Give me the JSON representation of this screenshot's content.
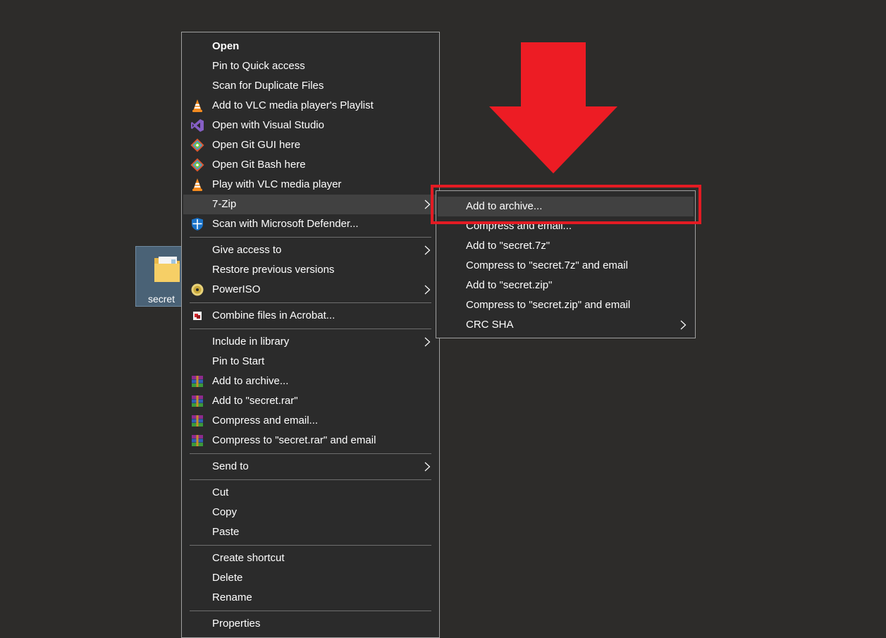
{
  "desktop": {
    "folder_label": "secret"
  },
  "context_menu": {
    "items": [
      {
        "label": "Open",
        "icon": "none",
        "bold": true
      },
      {
        "label": "Pin to Quick access",
        "icon": "none"
      },
      {
        "label": "Scan for Duplicate Files",
        "icon": "none"
      },
      {
        "label": "Add to VLC media player's Playlist",
        "icon": "vlc-cone-icon"
      },
      {
        "label": "Open with Visual Studio",
        "icon": "visual-studio-icon"
      },
      {
        "label": "Open Git GUI here",
        "icon": "git-icon"
      },
      {
        "label": "Open Git Bash here",
        "icon": "git-icon"
      },
      {
        "label": "Play with VLC media player",
        "icon": "vlc-cone-icon"
      },
      {
        "label": "7-Zip",
        "icon": "none",
        "submenu": true,
        "highlighted": true
      },
      {
        "label": "Scan with Microsoft Defender...",
        "icon": "defender-shield-icon"
      },
      {
        "label": "Give access to",
        "icon": "none",
        "submenu": true
      },
      {
        "label": "Restore previous versions",
        "icon": "none"
      },
      {
        "label": "PowerISO",
        "icon": "poweriso-disc-icon",
        "submenu": true
      },
      {
        "label": "Combine files in Acrobat...",
        "icon": "acrobat-icon"
      },
      {
        "label": "Include in library",
        "icon": "none",
        "submenu": true
      },
      {
        "label": "Pin to Start",
        "icon": "none"
      },
      {
        "label": "Add to archive...",
        "icon": "winrar-icon"
      },
      {
        "label": "Add to \"secret.rar\"",
        "icon": "winrar-icon"
      },
      {
        "label": "Compress and email...",
        "icon": "winrar-icon"
      },
      {
        "label": "Compress to \"secret.rar\" and email",
        "icon": "winrar-icon"
      },
      {
        "label": "Send to",
        "icon": "none",
        "submenu": true
      },
      {
        "label": "Cut",
        "icon": "none"
      },
      {
        "label": "Copy",
        "icon": "none"
      },
      {
        "label": "Paste",
        "icon": "none"
      },
      {
        "label": "Create shortcut",
        "icon": "none"
      },
      {
        "label": "Delete",
        "icon": "none"
      },
      {
        "label": "Rename",
        "icon": "none"
      },
      {
        "label": "Properties",
        "icon": "none"
      }
    ]
  },
  "zip_submenu": {
    "items": [
      {
        "label": "Add to archive...",
        "highlighted": true
      },
      {
        "label": "Compress and email..."
      },
      {
        "label": "Add to \"secret.7z\""
      },
      {
        "label": "Compress to \"secret.7z\" and email"
      },
      {
        "label": "Add to \"secret.zip\""
      },
      {
        "label": "Compress to \"secret.zip\" and email"
      },
      {
        "label": "CRC SHA",
        "submenu": true
      }
    ]
  },
  "colors": {
    "desktop_background": "#2d2c2a",
    "menu_background": "#2b2b2b",
    "highlight": "#414141",
    "annotation_red": "#e31b23"
  }
}
